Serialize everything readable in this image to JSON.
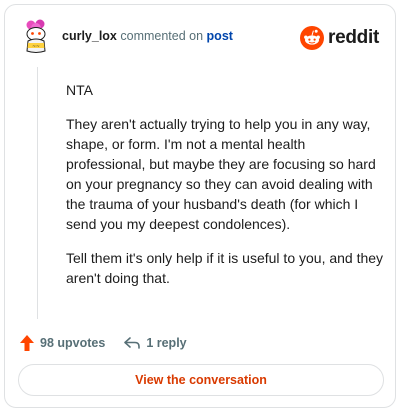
{
  "header": {
    "username": "curly_lox",
    "action_text": "commented on",
    "target_text": "post",
    "brand_name": "reddit",
    "avatar_icon": "snoo-avatar-icon",
    "brand_icon": "reddit-logo-icon"
  },
  "comment": {
    "paragraphs": [
      "NTA",
      "They aren't actually trying to help you in any way, shape, or form. I'm not a mental health professional, but maybe they are focusing so hard on your pregnancy so they can avoid dealing with the trauma of your husband's death (for which I send you my deepest condolences).",
      "Tell them it's only help if it is useful to you, and they aren't doing that."
    ]
  },
  "actions": {
    "upvotes_label": "98 upvotes",
    "replies_label": "1 reply",
    "upvote_icon": "upvote-arrow-icon",
    "reply_icon": "reply-arrow-icon"
  },
  "cta": {
    "label": "View the conversation"
  },
  "colors": {
    "brand_orange": "#ff4500",
    "link_blue": "#0045ac",
    "cta_text": "#d93a00",
    "meta_gray": "#576f76",
    "border": "#dfe1e3"
  }
}
